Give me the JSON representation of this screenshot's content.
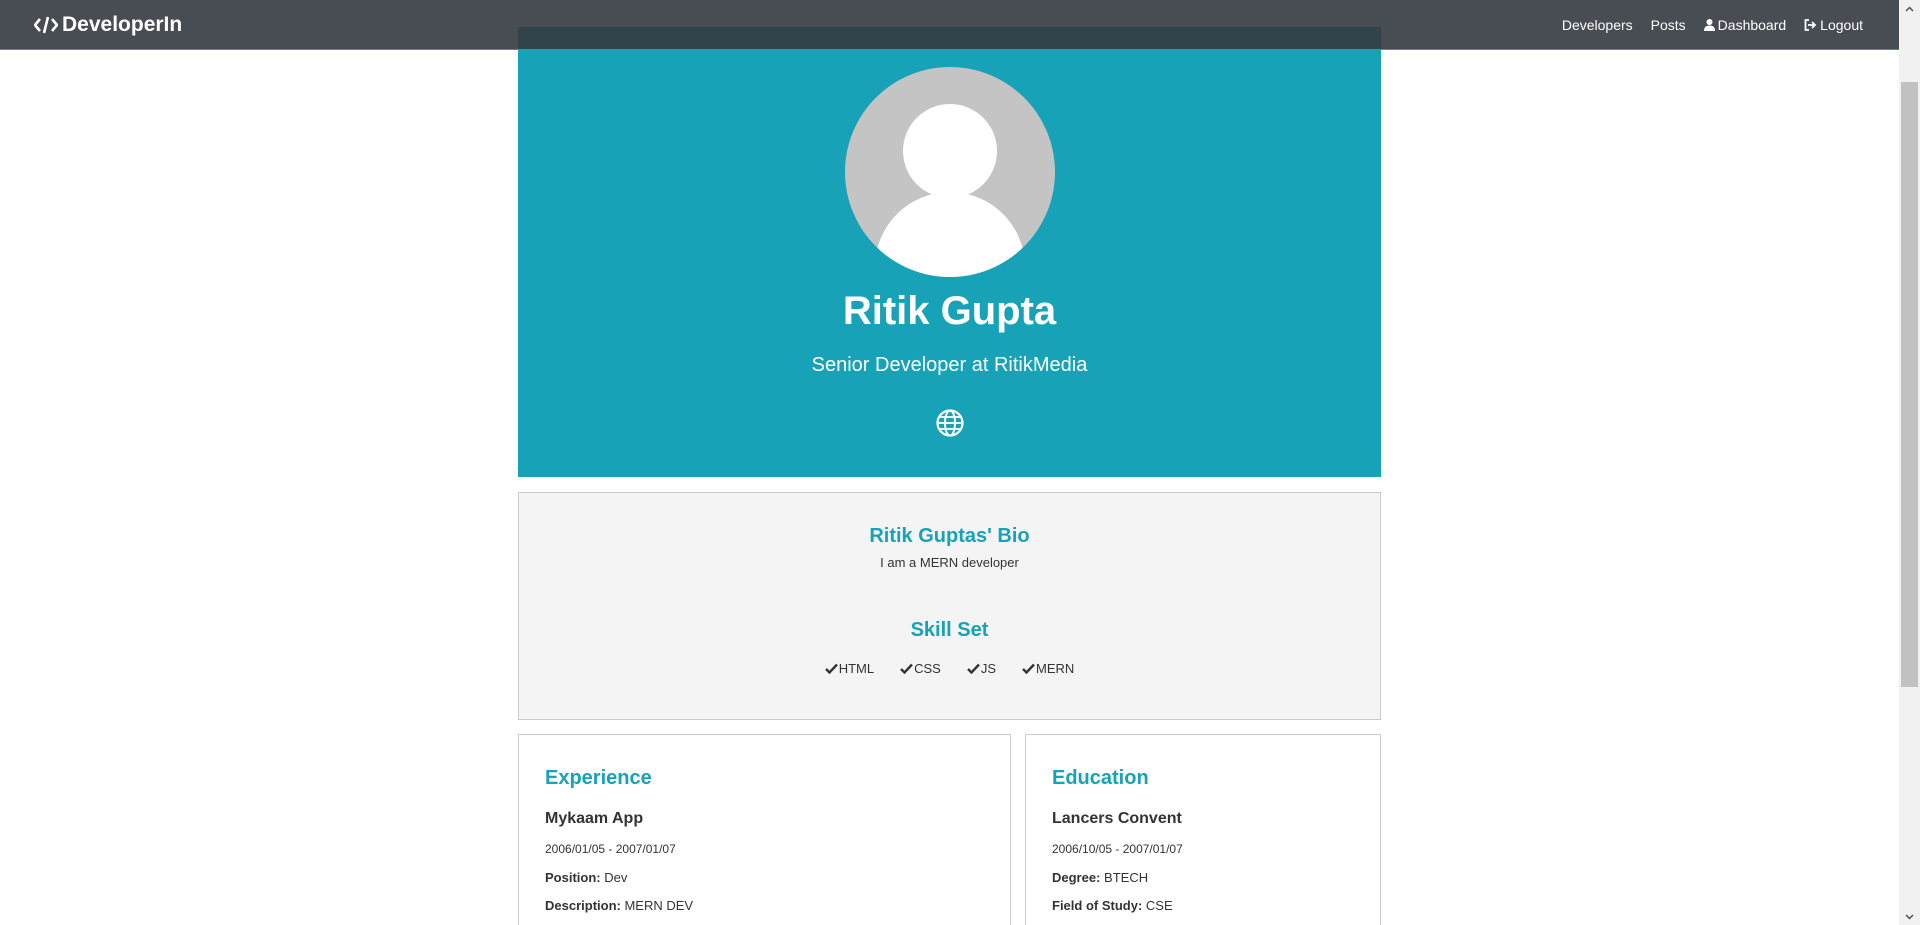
{
  "navbar": {
    "brand": "DeveloperIn",
    "links": {
      "developers": "Developers",
      "posts": "Posts",
      "dashboard": "Dashboard",
      "logout": "Logout"
    }
  },
  "profile": {
    "name": "Ritik Gupta",
    "title": "Senior Developer at RitikMedia"
  },
  "bio": {
    "heading": "Ritik Guptas' Bio",
    "text": "I am a MERN developer",
    "skills_heading": "Skill Set",
    "skills": [
      "HTML",
      "CSS",
      "JS",
      "MERN"
    ]
  },
  "experience": {
    "heading": "Experience",
    "company": "Mykaam App",
    "dates": "2006/01/05 - 2007/01/07",
    "position_label": "Position:",
    "position": "Dev",
    "description_label": "Description:",
    "description": "MERN DEV"
  },
  "education": {
    "heading": "Education",
    "school": "Lancers Convent",
    "dates": "2006/10/05 - 2007/01/07",
    "degree_label": "Degree:",
    "degree": "BTECH",
    "field_label": "Field of Study:",
    "field": "CSE"
  },
  "colors": {
    "accent": "#17a2b8",
    "navbar": "#343a40",
    "bio_bg": "#f4f4f4"
  },
  "icons": {
    "brand": "code-icon",
    "dashboard": "user-icon",
    "logout": "sign-out-icon",
    "website": "globe-icon",
    "skill": "check-icon"
  }
}
